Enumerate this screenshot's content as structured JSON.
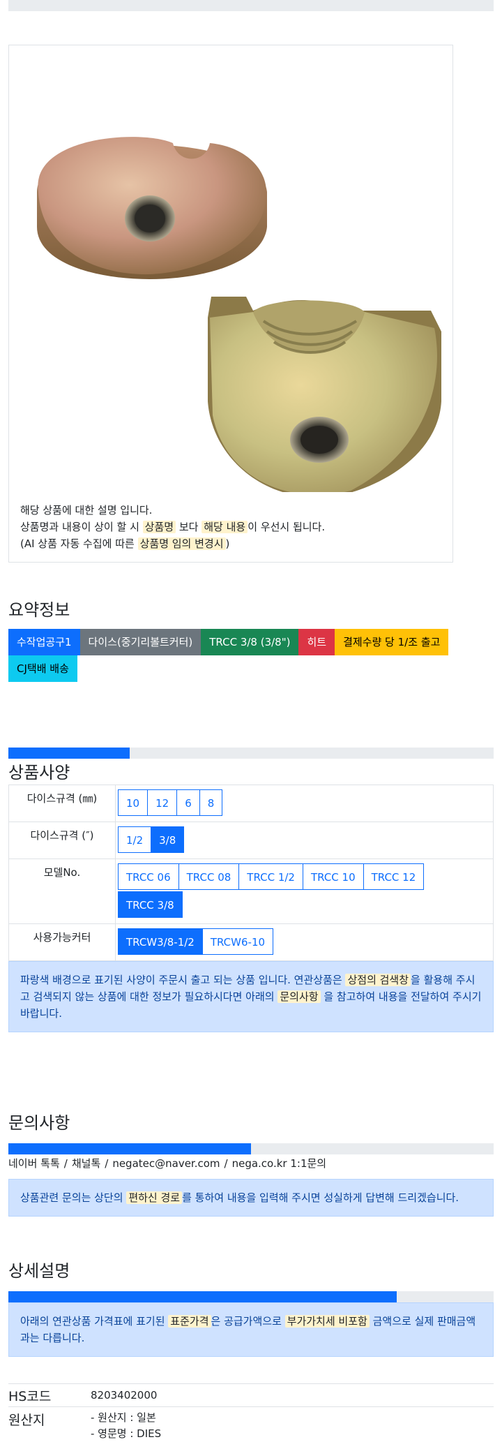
{
  "product": {
    "notice_line1": "해당 상품에 대한 설명 입니다.",
    "notice_line2_a": "상품명과 내용이 상이 할 시",
    "notice_line2_hl1": "상품명",
    "notice_line2_b": "보다",
    "notice_line2_hl2": "해당 내용",
    "notice_line2_c": "이 우선시 됩니다.",
    "notice_line3_a": "(AI 상품 자동 수집에 따른",
    "notice_line3_hl": "상품명 임의 변경시",
    "notice_line3_b": ")"
  },
  "summary": {
    "title": "요약정보",
    "badges": [
      "수작업공구1",
      "다이스(중기리볼트커터)",
      "TRCC 3/8 (3/8\")",
      "히트",
      "결제수량 당 1/조 출고",
      "CJ택배 배송"
    ]
  },
  "spec": {
    "title": "상품사양",
    "progress_pct": 25,
    "rows": [
      {
        "label": "다이스규격 (㎜)",
        "options": [
          "10",
          "12",
          "6",
          "8"
        ],
        "active": []
      },
      {
        "label": "다이스규격 (″)",
        "options": [
          "1/2",
          "3/8"
        ],
        "active": [
          "3/8"
        ]
      },
      {
        "label": "모델No.",
        "options": [
          "TRCC 06",
          "TRCC 08",
          "TRCC 1/2",
          "TRCC 10",
          "TRCC 12",
          "TRCC 3/8"
        ],
        "active": [
          "TRCC 3/8"
        ]
      },
      {
        "label": "사용가능커터",
        "options": [
          "TRCW3/8-1/2",
          "TRCW6-10"
        ],
        "active": [
          "TRCW3/8-1/2"
        ]
      }
    ],
    "alert_a": "파랑색 배경으로 표기된 사양이 주문시 출고 되는 상품 입니다. 연관상품은",
    "alert_hl1": "상점의 검색창",
    "alert_b": "을 활용해 주시고 검색되지 않는 상품에 대한 정보가 필요하시다면 아래의",
    "alert_hl2": "문의사항",
    "alert_c": "을 참고하여 내용을 전달하여 주시기 바랍니다."
  },
  "inquiry": {
    "title": "문의사항",
    "progress_pct": 50,
    "links": [
      "네이버 톡톡",
      "채널톡",
      "negatec@naver.com",
      "nega.co.kr 1:1문의"
    ],
    "alert_a": "상품관련 문의는 상단의",
    "alert_hl": "편하신 경로",
    "alert_b": "를 통하여 내용을 입력해 주시면 성실하게 답변해 드리겠습니다."
  },
  "detail": {
    "title": "상세설명",
    "progress_pct": 80,
    "alert_a": "아래의 연관상품 가격표에 표기된",
    "alert_hl1": "표준가격",
    "alert_b": "은 공급가액으로",
    "alert_hl2": "부가가치세 비포함",
    "alert_c": "금액으로 실제 판매금액과는 다릅니다.",
    "hs_label": "HS코드",
    "hs_value": "8203402000",
    "origin_label": "원산지",
    "origin_line1": "- 원산지 : 일본",
    "origin_line2": "- 영문명 : DIES"
  },
  "colors": {
    "primary": "#0d6efd",
    "secondary": "#6c757d",
    "success": "#198754",
    "danger": "#dc3545",
    "warning": "#ffc107",
    "info": "#0dcaf0"
  }
}
